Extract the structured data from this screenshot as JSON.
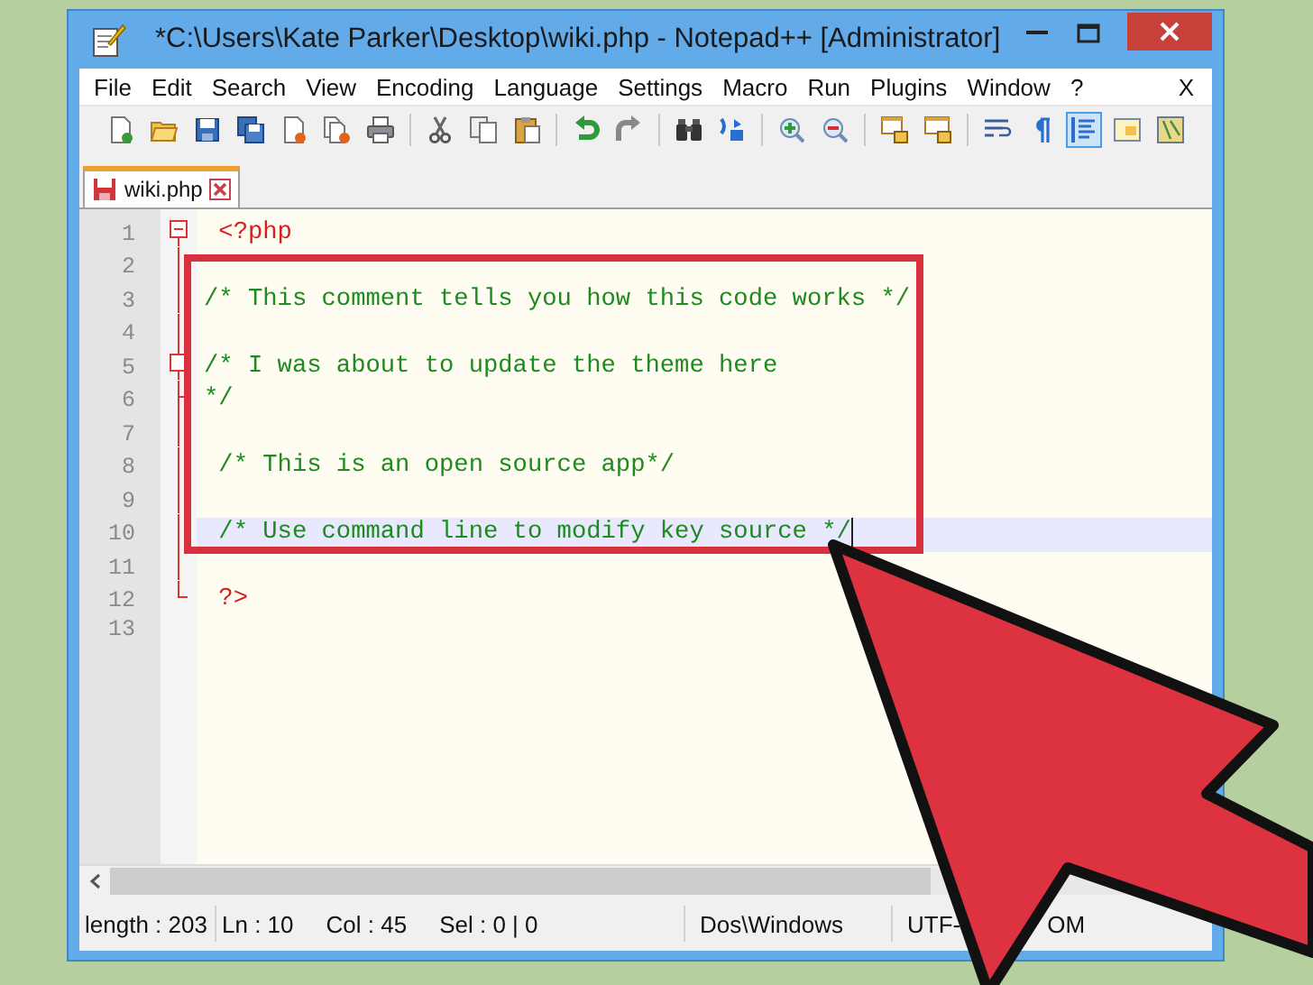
{
  "window": {
    "title": "*C:\\Users\\Kate Parker\\Desktop\\wiki.php - Notepad++ [Administrator]"
  },
  "menu": {
    "items": [
      "File",
      "Edit",
      "Search",
      "View",
      "Encoding",
      "Language",
      "Settings",
      "Macro",
      "Run",
      "Plugins",
      "Window",
      "?"
    ],
    "close": "X"
  },
  "toolbar": [
    {
      "buttons": [
        {
          "on": false
        },
        {
          "on": false
        },
        {
          "on": false
        },
        {
          "on": false
        },
        {
          "on": false
        },
        {
          "on": false
        },
        {
          "on": false
        }
      ]
    },
    {
      "buttons": [
        {
          "on": false
        },
        {
          "on": false
        },
        {
          "on": false
        }
      ]
    },
    {
      "buttons": [
        {
          "on": false
        },
        {
          "on": false
        }
      ]
    },
    {
      "buttons": [
        {
          "on": false
        },
        {
          "on": false
        }
      ]
    },
    {
      "buttons": [
        {
          "on": false
        },
        {
          "on": false
        }
      ]
    },
    {
      "buttons": [
        {
          "on": false
        },
        {
          "on": false
        }
      ]
    },
    {
      "buttons": [
        {
          "on": false
        },
        {
          "on": false
        },
        {
          "on": true
        },
        {
          "on": false
        },
        {
          "on": false
        }
      ]
    }
  ],
  "tabs": [
    {
      "label": "wiki.php",
      "selected": true,
      "modified": true
    }
  ],
  "editor": {
    "lines": [
      {
        "number": "1",
        "text": " <?php",
        "kind": "php",
        "fold": {
          "kind": "start"
        },
        "current": false
      },
      {
        "number": "2",
        "fold": {
          "kind": "body"
        },
        "current": false
      },
      {
        "number": "3",
        "text": "/* This comment tells you how this code works */",
        "kind": "comment",
        "fold": {
          "kind": "body"
        },
        "current": false
      },
      {
        "number": "4",
        "fold": {
          "kind": "body"
        },
        "current": false
      },
      {
        "number": "5",
        "text": "/* I was about to update the theme here",
        "kind": "comment",
        "fold": {
          "kind": "substart"
        },
        "current": false
      },
      {
        "number": "6",
        "text": "*/",
        "kind": "comment",
        "fold": {
          "kind": "subend"
        },
        "current": false
      },
      {
        "number": "7",
        "fold": {
          "kind": "body"
        },
        "current": false
      },
      {
        "number": "8",
        "text": " /* This is an open source app*/",
        "kind": "comment",
        "fold": {
          "kind": "body"
        },
        "current": false
      },
      {
        "number": "9",
        "fold": {
          "kind": "body"
        },
        "current": false
      },
      {
        "number": "10",
        "text": " /* Use command line to modify key source */",
        "kind": "comment",
        "fold": {
          "kind": "body"
        },
        "current": true
      },
      {
        "number": "11",
        "fold": {
          "kind": "body"
        },
        "current": false
      },
      {
        "number": "12",
        "text": " ?>",
        "kind": "php",
        "fold": {
          "kind": "end"
        },
        "current": false
      },
      {
        "number": "13",
        "current": false
      }
    ]
  },
  "status_bar": {
    "length": "length : 203",
    "line": "Ln : 10",
    "column": "Col : 45",
    "selection": "Sel : 0 | 0",
    "eol": "Dos\\Windows",
    "encoding_start": "UTF-",
    "encoding_end": "OM"
  },
  "annotations": [
    {
      "kind": "rectangle"
    },
    {
      "kind": "arrow"
    }
  ]
}
